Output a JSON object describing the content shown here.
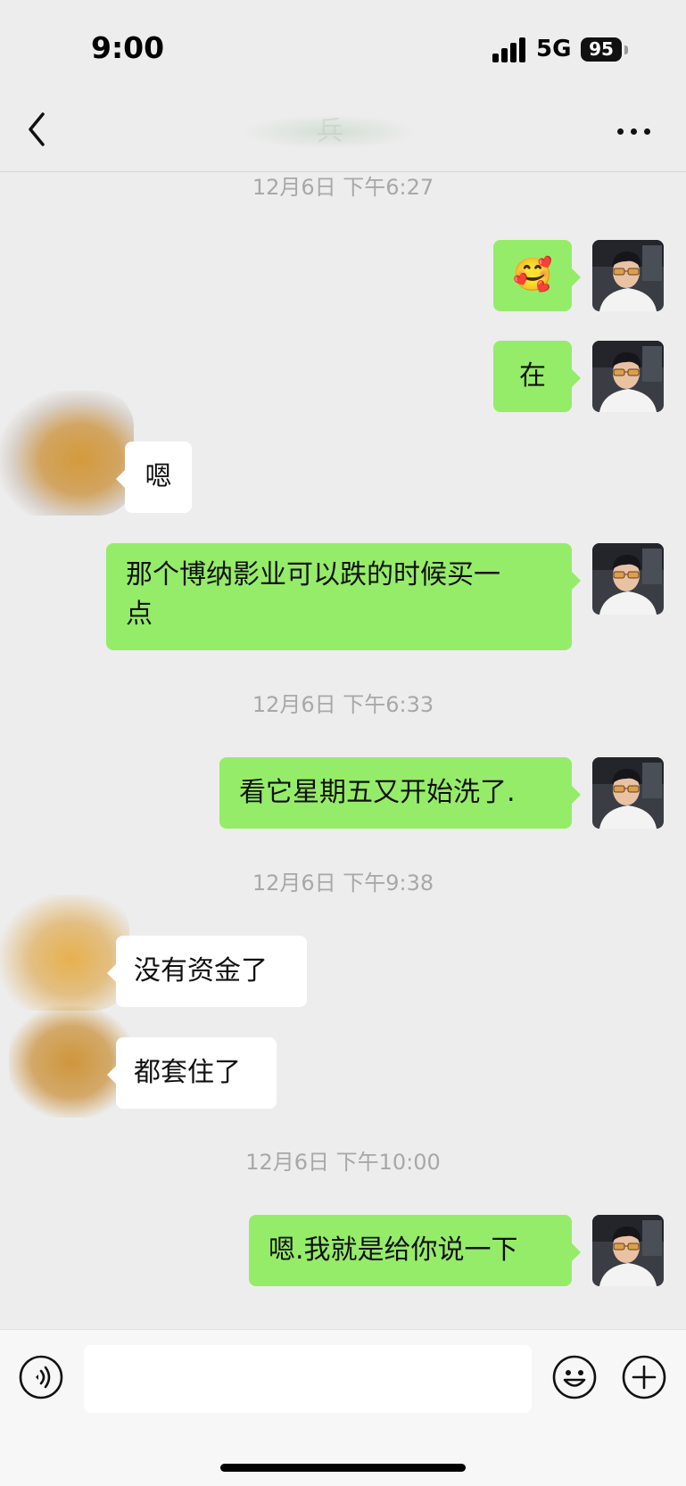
{
  "status_bar": {
    "time": "9:00",
    "network": "5G",
    "battery": "95"
  },
  "header": {
    "title": "兵"
  },
  "messages": {
    "ts1": "12月6日 下午6:27",
    "m1_emoji": "🥰",
    "m2": "在",
    "m3": "嗯",
    "m4_line1": "那个博纳影业可以跌的时候买一",
    "m4_line2": "点",
    "ts2": "12月6日 下午6:33",
    "m5": "看它星期五又开始洗了.",
    "ts3": "12月6日 下午9:38",
    "m6": "没有资金了",
    "m7": "都套住了",
    "ts4": "12月6日 下午10:00",
    "m8": "嗯.我就是给你说一下"
  },
  "input": {
    "placeholder": ""
  },
  "icons": {
    "back": "chevron-left-icon",
    "more": "more-dots-icon",
    "voice": "voice-icon",
    "emoji": "emoji-face-icon",
    "plus": "plus-circle-icon"
  },
  "colors": {
    "my_bubble": "#95ec69",
    "their_bubble": "#ffffff",
    "background": "#ededed",
    "timestamp": "#a8a8a8"
  }
}
